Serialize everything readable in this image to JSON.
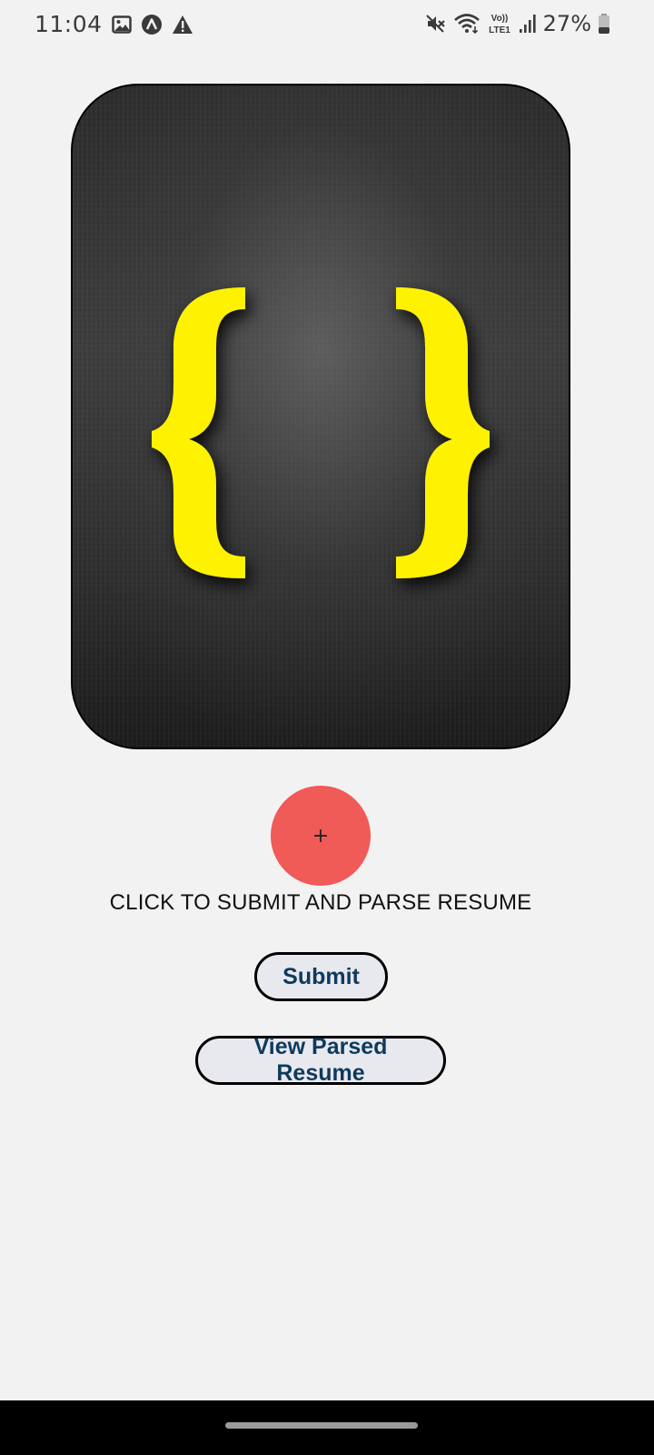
{
  "status_bar": {
    "time": "11:04",
    "battery_percent": "27%",
    "network_label_top": "Vo))",
    "network_label_bottom": "LTE1",
    "icons": [
      "gallery-icon",
      "app-notification-icon",
      "warning-icon",
      "mute-icon",
      "wifi-icon",
      "volte-lte-icon",
      "signal-icon",
      "battery-icon"
    ]
  },
  "hero": {
    "icon": "curly-braces-logo",
    "brace_color": "#fff200"
  },
  "fab": {
    "label": "+",
    "color": "#f05a57"
  },
  "instruction_text": "CLICK TO SUBMIT AND PARSE RESUME",
  "buttons": {
    "submit_label": "Submit",
    "view_parsed_label": "View Parsed Resume"
  }
}
